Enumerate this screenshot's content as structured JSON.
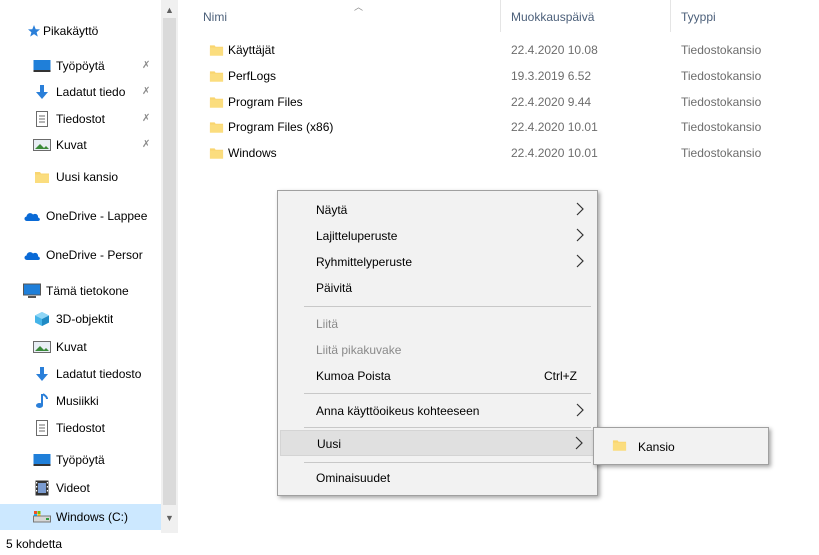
{
  "nav": {
    "items": [
      {
        "label": "Pikakäyttö",
        "icon": "star-icon",
        "pinned": false
      },
      {
        "label": "Työpöytä",
        "icon": "desktop-icon",
        "pinned": true
      },
      {
        "label": "Ladatut tiedo",
        "icon": "download-icon",
        "pinned": true
      },
      {
        "label": "Tiedostot",
        "icon": "document-icon",
        "pinned": true
      },
      {
        "label": "Kuvat",
        "icon": "pictures-icon",
        "pinned": true
      },
      {
        "label": "Uusi kansio",
        "icon": "folder-icon",
        "pinned": false
      },
      {
        "label": "OneDrive - Lappee",
        "icon": "cloud-icon",
        "pinned": false
      },
      {
        "label": "OneDrive - Persor",
        "icon": "cloud-icon",
        "pinned": false
      },
      {
        "label": "Tämä tietokone",
        "icon": "computer-icon",
        "pinned": false
      },
      {
        "label": "3D-objektit",
        "icon": "cube-icon",
        "pinned": false
      },
      {
        "label": "Kuvat",
        "icon": "pictures-icon",
        "pinned": false
      },
      {
        "label": "Ladatut tiedosto",
        "icon": "download-icon",
        "pinned": false
      },
      {
        "label": "Musiikki",
        "icon": "music-icon",
        "pinned": false
      },
      {
        "label": "Tiedostot",
        "icon": "document-icon",
        "pinned": false
      },
      {
        "label": "Työpöytä",
        "icon": "desktop-icon",
        "pinned": false
      },
      {
        "label": "Videot",
        "icon": "video-icon",
        "pinned": false
      },
      {
        "label": "Windows (C:)",
        "icon": "drive-icon",
        "pinned": false,
        "selected": true
      }
    ]
  },
  "list": {
    "columns": [
      "Nimi",
      "Muokkauspäivä",
      "Tyyppi"
    ],
    "files": [
      {
        "name": "Käyttäjät",
        "date": "22.4.2020 10.08",
        "type": "Tiedostokansio"
      },
      {
        "name": "PerfLogs",
        "date": "19.3.2019 6.52",
        "type": "Tiedostokansio"
      },
      {
        "name": "Program Files",
        "date": "22.4.2020 9.44",
        "type": "Tiedostokansio"
      },
      {
        "name": "Program Files (x86)",
        "date": "22.4.2020 10.01",
        "type": "Tiedostokansio"
      },
      {
        "name": "Windows",
        "date": "22.4.2020 10.01",
        "type": "Tiedostokansio"
      }
    ]
  },
  "status": {
    "count": "5 kohdetta"
  },
  "context_menu": {
    "items": [
      {
        "label": "Näytä",
        "submenu": true
      },
      {
        "label": "Lajitteluperuste",
        "submenu": true
      },
      {
        "label": "Ryhmittelyperuste",
        "submenu": true
      },
      {
        "label": "Päivitä"
      },
      {
        "label": "Liitä",
        "disabled": true
      },
      {
        "label": "Liitä pikakuvake",
        "disabled": true
      },
      {
        "label": "Kumoa Poista",
        "shortcut": "Ctrl+Z"
      },
      {
        "label": "Anna käyttöoikeus kohteeseen",
        "submenu": true
      },
      {
        "label": "Uusi",
        "submenu": true,
        "hover": true
      },
      {
        "label": "Ominaisuudet"
      }
    ]
  },
  "submenu": {
    "items": [
      {
        "label": "Kansio",
        "icon": "folder-icon"
      }
    ]
  },
  "colors": {
    "header_text": "#4c607a",
    "folder_yellow": "#f9d570",
    "selection": "#cce8ff",
    "menu_bg": "#f2f2f2",
    "onedrive_blue": "#0a6ad6"
  }
}
